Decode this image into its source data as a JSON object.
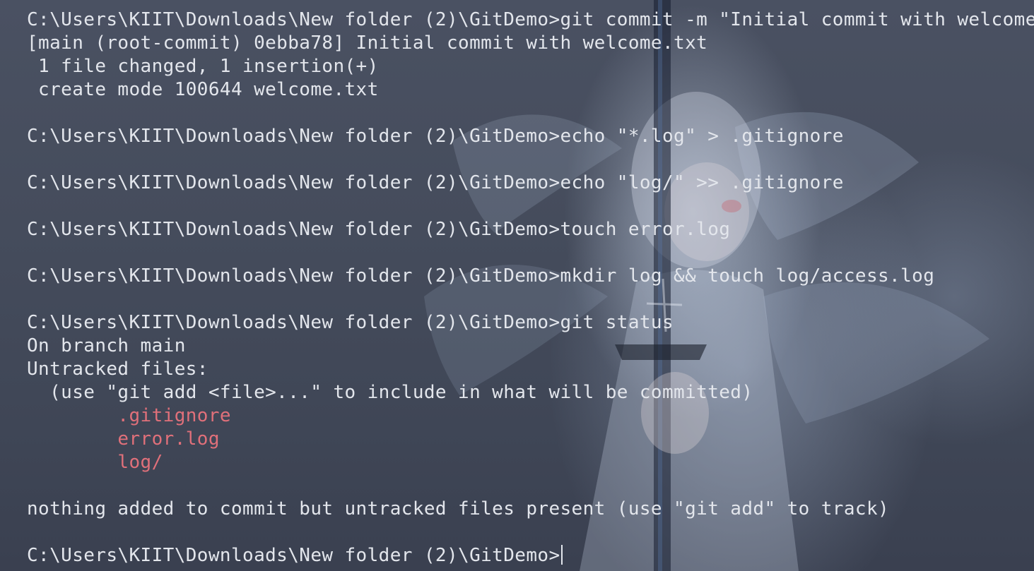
{
  "terminal": {
    "lines": [
      {
        "text": "C:\\Users\\KIIT\\Downloads\\New folder (2)\\GitDemo>git commit -m \"Initial commit with welcome.txt\""
      },
      {
        "text": "[main (root-commit) 0ebba78] Initial commit with welcome.txt"
      },
      {
        "text": " 1 file changed, 1 insertion(+)"
      },
      {
        "text": " create mode 100644 welcome.txt"
      },
      {
        "text": ""
      },
      {
        "text": "C:\\Users\\KIIT\\Downloads\\New folder (2)\\GitDemo>echo \"*.log\" > .gitignore"
      },
      {
        "text": ""
      },
      {
        "text": "C:\\Users\\KIIT\\Downloads\\New folder (2)\\GitDemo>echo \"log/\" >> .gitignore"
      },
      {
        "text": ""
      },
      {
        "text": "C:\\Users\\KIIT\\Downloads\\New folder (2)\\GitDemo>touch error.log"
      },
      {
        "text": ""
      },
      {
        "text": "C:\\Users\\KIIT\\Downloads\\New folder (2)\\GitDemo>mkdir log && touch log/access.log"
      },
      {
        "text": ""
      },
      {
        "text": "C:\\Users\\KIIT\\Downloads\\New folder (2)\\GitDemo>git status"
      },
      {
        "text": "On branch main"
      },
      {
        "text": "Untracked files:"
      },
      {
        "text": "  (use \"git add <file>...\" to include in what will be committed)"
      },
      {
        "text": "        .gitignore"
      },
      {
        "text": "        error.log"
      },
      {
        "text": "        log/"
      },
      {
        "text": ""
      },
      {
        "text": "nothing added to commit but untracked files present (use \"git add\" to track)"
      },
      {
        "text": ""
      },
      {
        "text": "C:\\Users\\KIIT\\Downloads\\New folder (2)\\GitDemo>"
      }
    ],
    "colors": {
      "foreground": "#e3e6ec",
      "untracked": "#e0707a",
      "background": "#434a5a"
    }
  }
}
